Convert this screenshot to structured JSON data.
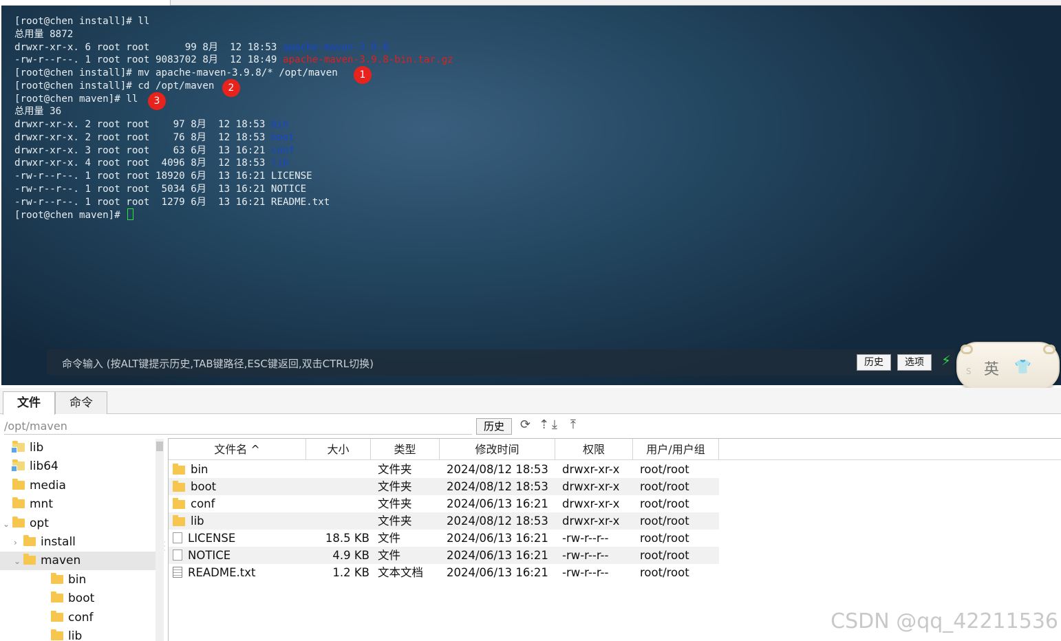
{
  "terminal": {
    "lines": [
      [
        {
          "t": "[root@chen install]# ll"
        }
      ],
      [
        {
          "t": "总用量 8872"
        }
      ],
      [
        {
          "t": "drwxr-xr-x. 6 root root      99 8月  12 18:53 "
        },
        {
          "t": "apache-maven-3.9.8",
          "c": "blue"
        }
      ],
      [
        {
          "t": "-rw-r--r--. 1 root root 9083702 8月  12 18:49 "
        },
        {
          "t": "apache-maven-3.9.8-bin.tar.gz",
          "c": "red"
        }
      ],
      [
        {
          "t": "[root@chen install]# mv apache-maven-3.9.8/* /opt/maven"
        }
      ],
      [
        {
          "t": "[root@chen install]# cd /opt/maven"
        }
      ],
      [
        {
          "t": "[root@chen maven]# ll"
        }
      ],
      [
        {
          "t": "总用量 36"
        }
      ],
      [
        {
          "t": "drwxr-xr-x. 2 root root    97 8月  12 18:53 "
        },
        {
          "t": "bin",
          "c": "blue"
        }
      ],
      [
        {
          "t": "drwxr-xr-x. 2 root root    76 8月  12 18:53 "
        },
        {
          "t": "boot",
          "c": "blue"
        }
      ],
      [
        {
          "t": "drwxr-xr-x. 3 root root    63 6月  13 16:21 "
        },
        {
          "t": "conf",
          "c": "blue"
        }
      ],
      [
        {
          "t": "drwxr-xr-x. 4 root root  4096 8月  12 18:53 "
        },
        {
          "t": "lib",
          "c": "blue"
        }
      ],
      [
        {
          "t": "-rw-r--r--. 1 root root 18920 6月  13 16:21 LICENSE"
        }
      ],
      [
        {
          "t": "-rw-r--r--. 1 root root  5034 6月  13 16:21 NOTICE"
        }
      ],
      [
        {
          "t": "-rw-r--r--. 1 root root  1279 6月  13 16:21 README.txt"
        }
      ],
      [
        {
          "t": "[root@chen maven]# "
        },
        {
          "cursor": true
        }
      ]
    ],
    "markers": [
      "1",
      "2",
      "3"
    ],
    "command_placeholder": "命令输入 (按ALT键提示历史,TAB键路径,ESC键返回,双击CTRL切换)",
    "history_button": "历史",
    "options_button": "选项"
  },
  "ime": {
    "lang": "英",
    "logo": "S"
  },
  "tabs": [
    {
      "label": "文件",
      "active": true
    },
    {
      "label": "命令",
      "active": false
    }
  ],
  "path": {
    "value": "/opt/maven",
    "history_button": "历史"
  },
  "tree": {
    "items": [
      {
        "label": "lib",
        "link": true,
        "depth": 0
      },
      {
        "label": "lib64",
        "link": true,
        "depth": 0
      },
      {
        "label": "media",
        "depth": 0
      },
      {
        "label": "mnt",
        "depth": 0
      },
      {
        "label": "opt",
        "depth": 0,
        "expanded": true
      },
      {
        "label": "install",
        "depth": 1,
        "collapsed": true
      },
      {
        "label": "maven",
        "depth": 1,
        "expanded": true,
        "selected": true
      },
      {
        "label": "bin",
        "depth": 2
      },
      {
        "label": "boot",
        "depth": 2
      },
      {
        "label": "conf",
        "depth": 2
      },
      {
        "label": "lib",
        "depth": 2
      }
    ]
  },
  "files": {
    "columns": [
      "文件名 ^",
      "大小",
      "类型",
      "修改时间",
      "权限",
      "用户/用户组"
    ],
    "rows": [
      {
        "name": "bin",
        "size": "",
        "type": "文件夹",
        "mtime": "2024/08/12 18:53",
        "perm": "drwxr-xr-x",
        "owner": "root/root",
        "kind": "dir"
      },
      {
        "name": "boot",
        "size": "",
        "type": "文件夹",
        "mtime": "2024/08/12 18:53",
        "perm": "drwxr-xr-x",
        "owner": "root/root",
        "kind": "dir"
      },
      {
        "name": "conf",
        "size": "",
        "type": "文件夹",
        "mtime": "2024/06/13 16:21",
        "perm": "drwxr-xr-x",
        "owner": "root/root",
        "kind": "dir"
      },
      {
        "name": "lib",
        "size": "",
        "type": "文件夹",
        "mtime": "2024/08/12 18:53",
        "perm": "drwxr-xr-x",
        "owner": "root/root",
        "kind": "dir"
      },
      {
        "name": "LICENSE",
        "size": "18.5 KB",
        "type": "文件",
        "mtime": "2024/06/13 16:21",
        "perm": "-rw-r--r--",
        "owner": "root/root",
        "kind": "file"
      },
      {
        "name": "NOTICE",
        "size": "4.9 KB",
        "type": "文件",
        "mtime": "2024/06/13 16:21",
        "perm": "-rw-r--r--",
        "owner": "root/root",
        "kind": "file"
      },
      {
        "name": "README.txt",
        "size": "1.2 KB",
        "type": "文本文档",
        "mtime": "2024/06/13 16:21",
        "perm": "-rw-r--r--",
        "owner": "root/root",
        "kind": "txt"
      }
    ]
  },
  "watermark": "CSDN @qq_42211536",
  "colors": {
    "terminal_blue": "#1746c9",
    "terminal_red": "#e21d1d",
    "cursor_green": "#2ee23a",
    "marker_red": "#e8221d",
    "folder_yellow": "#f6c64f"
  }
}
